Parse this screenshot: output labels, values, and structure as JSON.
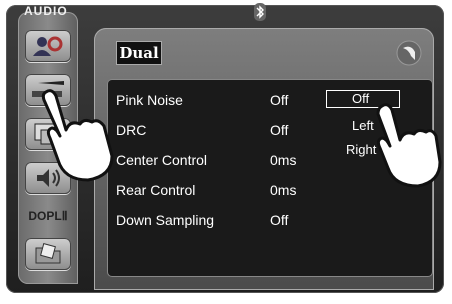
{
  "window": {
    "title": "AUDIO"
  },
  "brand": {
    "logo": "Dual"
  },
  "sidebar": {
    "items": [
      {
        "name": "settings",
        "icon": "people-gear-icon"
      },
      {
        "name": "eq",
        "icon": "pen-slider-icon"
      },
      {
        "name": "window",
        "icon": "window-icon"
      },
      {
        "name": "speaker",
        "icon": "speaker-icon"
      },
      {
        "name": "dolby",
        "label": "DOPLⅡ"
      },
      {
        "name": "folder",
        "icon": "folder-icon"
      }
    ]
  },
  "settings": {
    "rows": [
      {
        "label": "Pink Noise",
        "value": "Off"
      },
      {
        "label": "DRC",
        "value": "Off"
      },
      {
        "label": "Center Control",
        "value": "0ms"
      },
      {
        "label": "Rear  Control",
        "value": "0ms"
      },
      {
        "label": "Down  Sampling",
        "value": "Off"
      }
    ]
  },
  "pink_noise_options": {
    "options": [
      "Off",
      "Left",
      "Right"
    ],
    "selected": "Off"
  },
  "colors": {
    "panel_bg": "#1a1a1a",
    "frame_bg": "#2b2b2b",
    "text": "#ffffff"
  }
}
